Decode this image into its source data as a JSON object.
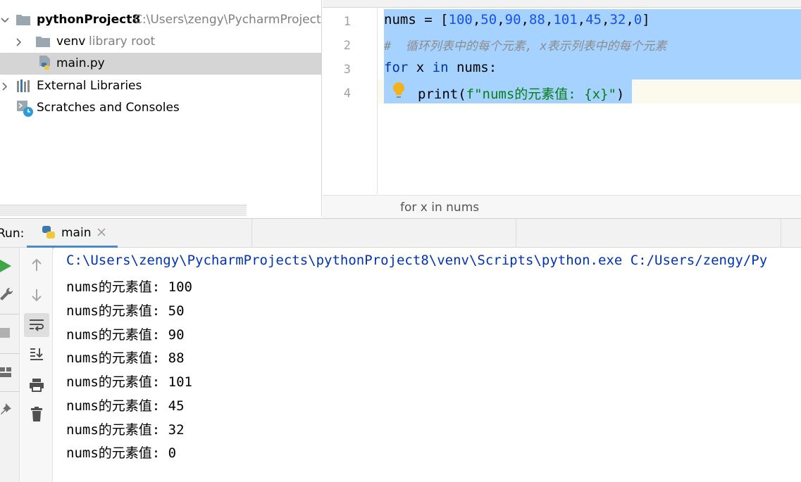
{
  "project": {
    "name": "pythonProject8",
    "path": "C:\\Users\\zengy\\PycharmProjects\\",
    "tree": [
      {
        "label": "venv",
        "note": "library root"
      },
      {
        "label": "main.py"
      },
      {
        "label": "External Libraries"
      },
      {
        "label": "Scratches and Consoles"
      }
    ]
  },
  "editor": {
    "line_numbers": [
      "1",
      "2",
      "3",
      "4"
    ],
    "code": {
      "l1_a": "nums = [",
      "l1_n1": "100",
      "l1_n2": "50",
      "l1_n3": "90",
      "l1_n4": "88",
      "l1_n5": "101",
      "l1_n6": "45",
      "l1_n7": "32",
      "l1_n8": "0",
      "comma": ",",
      "l1_end": "]",
      "l2_comment": "#  循环列表中的每个元素, x表示列表中的每个元素",
      "l3_for": "for",
      "l3_mid": " x ",
      "l3_in": "in",
      "l3_end": " nums:",
      "l4_print": "print(",
      "l4_str": "f\"nums的元素值: {x}\"",
      "l4_end": ")"
    },
    "breadcrumb": "for x in nums"
  },
  "run": {
    "label": "Run:",
    "tab_label": "main",
    "command": "C:\\Users\\zengy\\PycharmProjects\\pythonProject8\\venv\\Scripts\\python.exe C:/Users/zengy/Py",
    "output": [
      "nums的元素值: 100",
      "nums的元素值: 50",
      "nums的元素值: 90",
      "nums的元素值: 88",
      "nums的元素值: 101",
      "nums的元素值: 45",
      "nums的元素值: 32",
      "nums的元素值: 0"
    ]
  },
  "colors": {
    "selection": "#a6d2ff",
    "keyword": "#0033b3",
    "number": "#1750eb",
    "string": "#067d17",
    "comment": "#8c8c8c",
    "tab_underline": "#4a88c7",
    "run_green": "#3fa648"
  },
  "icons": [
    "folder-icon",
    "python-file-icon",
    "library-icon",
    "scratches-icon",
    "intention-bulb-icon",
    "python-icon",
    "close-icon",
    "run-icon",
    "wrench-icon",
    "stop-icon",
    "layout-icon",
    "pin-icon",
    "arrow-up-icon",
    "arrow-down-icon",
    "soft-wrap-icon",
    "scroll-to-end-icon",
    "print-icon",
    "trash-icon"
  ]
}
